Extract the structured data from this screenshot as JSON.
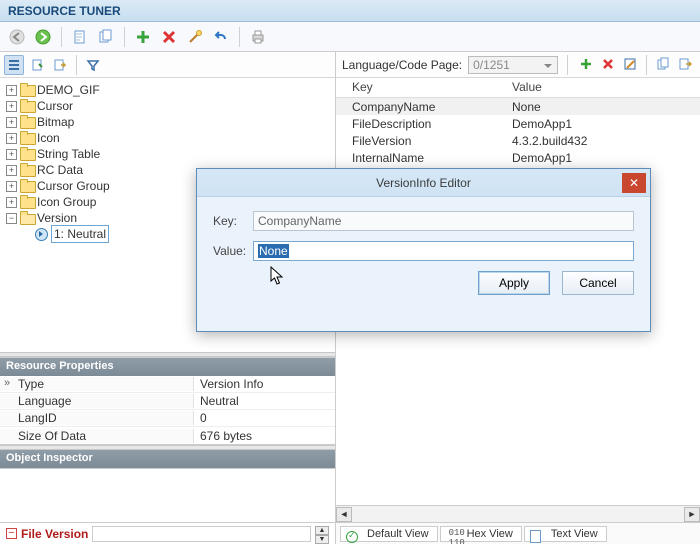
{
  "title": "RESOURCE TUNER",
  "toolbar_icons": [
    "back",
    "forward",
    "doc-new",
    "doc-dup",
    "add",
    "delete",
    "wand",
    "undo",
    "print"
  ],
  "left_toolbar": [
    "list-view",
    "page-view",
    "export-view",
    "filter"
  ],
  "tree": [
    {
      "label": "DEMO_GIF",
      "expand": "plus"
    },
    {
      "label": "Cursor",
      "expand": "plus"
    },
    {
      "label": "Bitmap",
      "expand": "plus"
    },
    {
      "label": "Icon",
      "expand": "plus"
    },
    {
      "label": "String Table",
      "expand": "plus"
    },
    {
      "label": "RC Data",
      "expand": "plus"
    },
    {
      "label": "Cursor Group",
      "expand": "plus"
    },
    {
      "label": "Icon Group",
      "expand": "plus"
    },
    {
      "label": "Version",
      "expand": "minus",
      "open": true,
      "children": [
        {
          "label": "1: Neutral",
          "selected": true
        }
      ]
    }
  ],
  "properties_header": "Resource Properties",
  "properties": [
    {
      "key": "Type",
      "value": "Version Info",
      "indicator": true
    },
    {
      "key": "Language",
      "value": "Neutral"
    },
    {
      "key": "LangID",
      "value": "0"
    },
    {
      "key": "Size Of Data",
      "value": "676 bytes"
    }
  ],
  "object_inspector_header": "Object Inspector",
  "file_version_label": "File Version",
  "file_version_value": "",
  "lang_label": "Language/Code Page:",
  "lang_value": "0/1251",
  "right_tools": [
    "add",
    "delete",
    "edit",
    "copy",
    "import"
  ],
  "kv_headers": {
    "key": "Key",
    "value": "Value"
  },
  "kv_rows": [
    {
      "k": "CompanyName",
      "v": "None",
      "sel": true
    },
    {
      "k": "FileDescription",
      "v": "DemoApp1"
    },
    {
      "k": "FileVersion",
      "v": "4.3.2.build432"
    },
    {
      "k": "InternalName",
      "v": "DemoApp1"
    }
  ],
  "view_tabs": [
    "Default View",
    "Hex View",
    "Text View"
  ],
  "dialog": {
    "title": "VersionInfo Editor",
    "key_label": "Key:",
    "key_value": "CompanyName",
    "value_label": "Value:",
    "value_value": "None",
    "apply": "Apply",
    "cancel": "Cancel"
  }
}
